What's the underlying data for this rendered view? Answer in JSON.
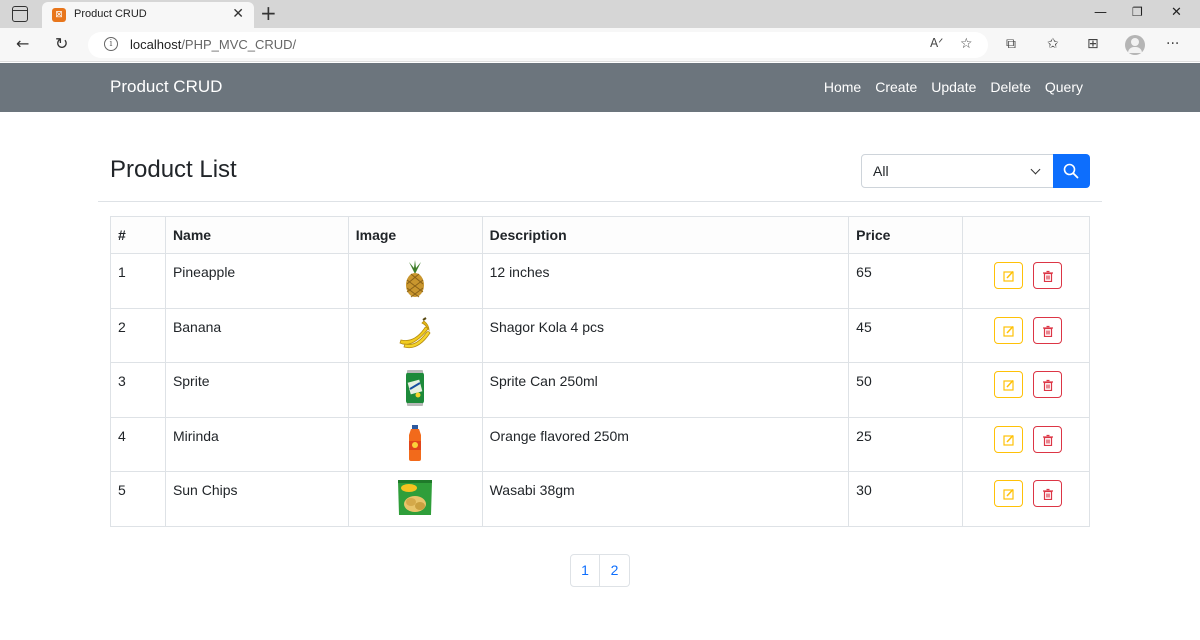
{
  "browser": {
    "tab_title": "Product CRUD",
    "url_host": "localhost",
    "url_path": "/PHP_MVC_CRUD/"
  },
  "navbar": {
    "brand": "Product CRUD",
    "links": [
      "Home",
      "Create",
      "Update",
      "Delete",
      "Query"
    ]
  },
  "page": {
    "title": "Product List",
    "filter_selected": "All"
  },
  "table": {
    "headers": [
      "#",
      "Name",
      "Image",
      "Description",
      "Price",
      ""
    ],
    "rows": [
      {
        "id": "1",
        "name": "Pineapple",
        "image": "pineapple",
        "description": "12 inches",
        "price": "65"
      },
      {
        "id": "2",
        "name": "Banana",
        "image": "banana",
        "description": "Shagor Kola 4 pcs",
        "price": "45"
      },
      {
        "id": "3",
        "name": "Sprite",
        "image": "sprite-can",
        "description": "Sprite Can 250ml",
        "price": "50"
      },
      {
        "id": "4",
        "name": "Mirinda",
        "image": "mirinda-bottle",
        "description": "Orange flavored 250m",
        "price": "25"
      },
      {
        "id": "5",
        "name": "Sun Chips",
        "image": "sun-chips-bag",
        "description": "Wasabi 38gm",
        "price": "30"
      }
    ]
  },
  "pagination": {
    "pages": [
      "1",
      "2"
    ]
  },
  "colors": {
    "navbar": "#6c757d",
    "primary": "#0d6efd",
    "warning": "#ffc107",
    "danger": "#dc3545"
  }
}
